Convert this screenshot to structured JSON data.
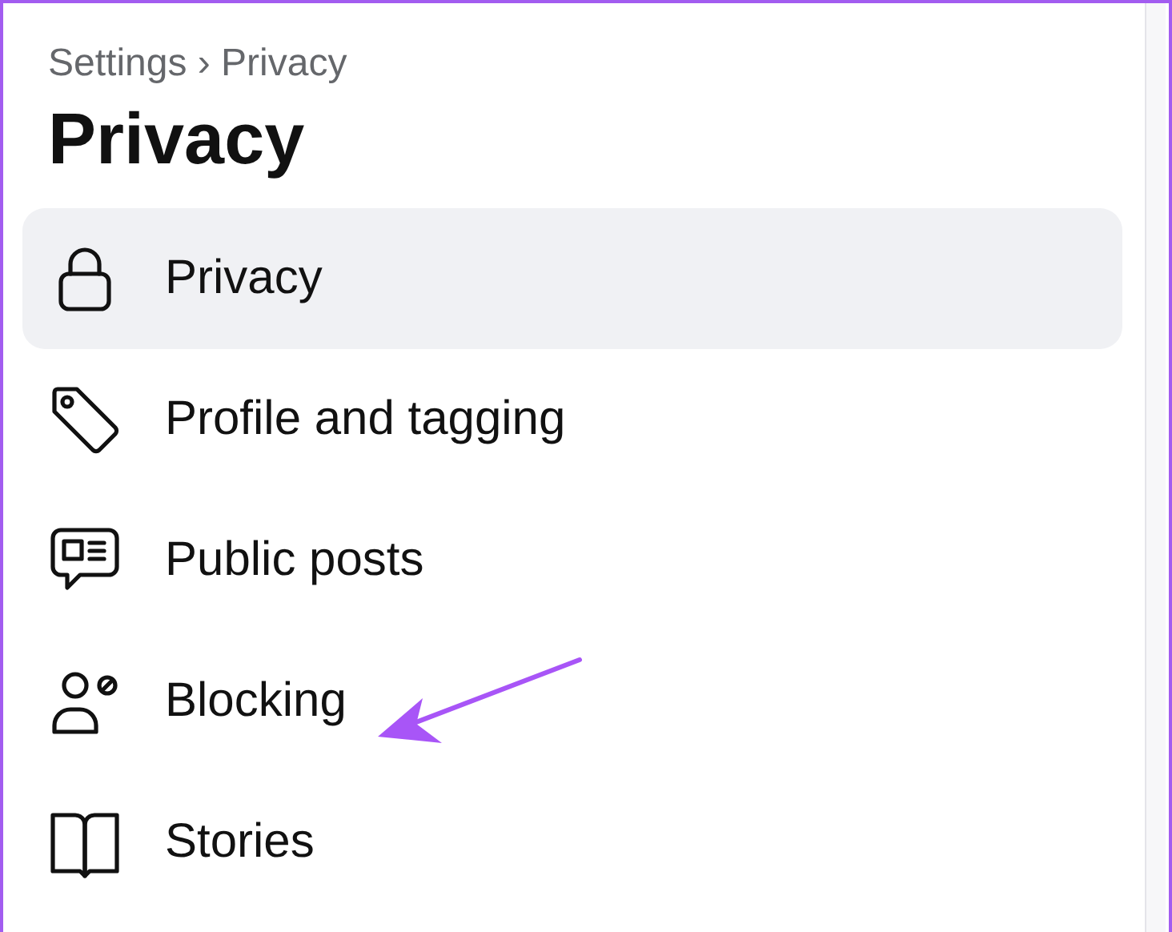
{
  "breadcrumb": "Settings › Privacy",
  "title": "Privacy",
  "items": [
    {
      "label": "Privacy",
      "selected": true
    },
    {
      "label": "Profile and tagging",
      "selected": false
    },
    {
      "label": "Public posts",
      "selected": false
    },
    {
      "label": "Blocking",
      "selected": false
    },
    {
      "label": "Stories",
      "selected": false
    }
  ]
}
